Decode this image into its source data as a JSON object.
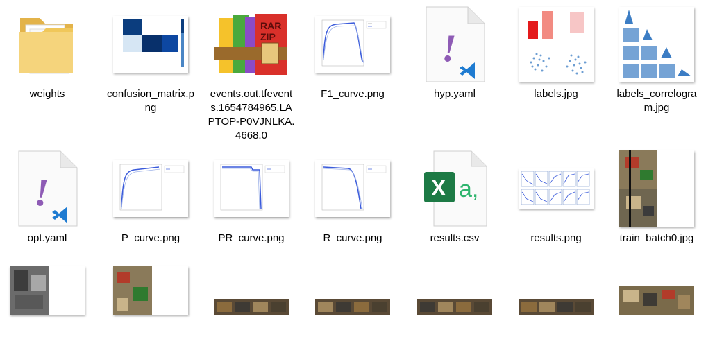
{
  "explorer": {
    "files": [
      {
        "name": "weights",
        "icon": "folder-icon"
      },
      {
        "name": "confusion_matrix.png",
        "icon": "confusion-matrix-thumbnail"
      },
      {
        "name": "events.out.tfevents.1654784965.LAPTOP-P0VJNLKA.4668.0",
        "icon": "rar-zip-archive-icon",
        "archive_text_1": "RAR",
        "archive_text_2": "ZIP"
      },
      {
        "name": "F1_curve.png",
        "icon": "f1-curve-thumbnail"
      },
      {
        "name": "hyp.yaml",
        "icon": "yaml-vscode-icon",
        "glyph": "!"
      },
      {
        "name": "labels.jpg",
        "icon": "labels-thumbnail"
      },
      {
        "name": "labels_correlogram.jpg",
        "icon": "labels-correlogram-thumbnail"
      },
      {
        "name": "opt.yaml",
        "icon": "yaml-vscode-icon",
        "glyph": "!"
      },
      {
        "name": "P_curve.png",
        "icon": "p-curve-thumbnail"
      },
      {
        "name": "PR_curve.png",
        "icon": "pr-curve-thumbnail"
      },
      {
        "name": "R_curve.png",
        "icon": "r-curve-thumbnail"
      },
      {
        "name": "results.csv",
        "icon": "excel-csv-icon",
        "excel_letter": "X",
        "csv_glyph": "a,"
      },
      {
        "name": "results.png",
        "icon": "results-thumbnail"
      },
      {
        "name": "train_batch0.jpg",
        "icon": "train-batch-thumbnail"
      },
      {
        "name": "",
        "icon": "photo-thumbnail"
      },
      {
        "name": "",
        "icon": "photo-thumbnail"
      },
      {
        "name": "",
        "icon": "photo-strip-thumbnail"
      },
      {
        "name": "",
        "icon": "photo-strip-thumbnail"
      },
      {
        "name": "",
        "icon": "photo-strip-thumbnail"
      },
      {
        "name": "",
        "icon": "photo-strip-thumbnail"
      },
      {
        "name": "",
        "icon": "photo-thumbnail"
      }
    ]
  },
  "colors": {
    "folder_yellow": "#f0c75a",
    "yaml_purple": "#8e5bb5",
    "vscode_blue": "#1e7bd1",
    "excel_green": "#1d7a45",
    "curve_blue": "#3b5bdb",
    "heat_blue": "#08306b"
  }
}
